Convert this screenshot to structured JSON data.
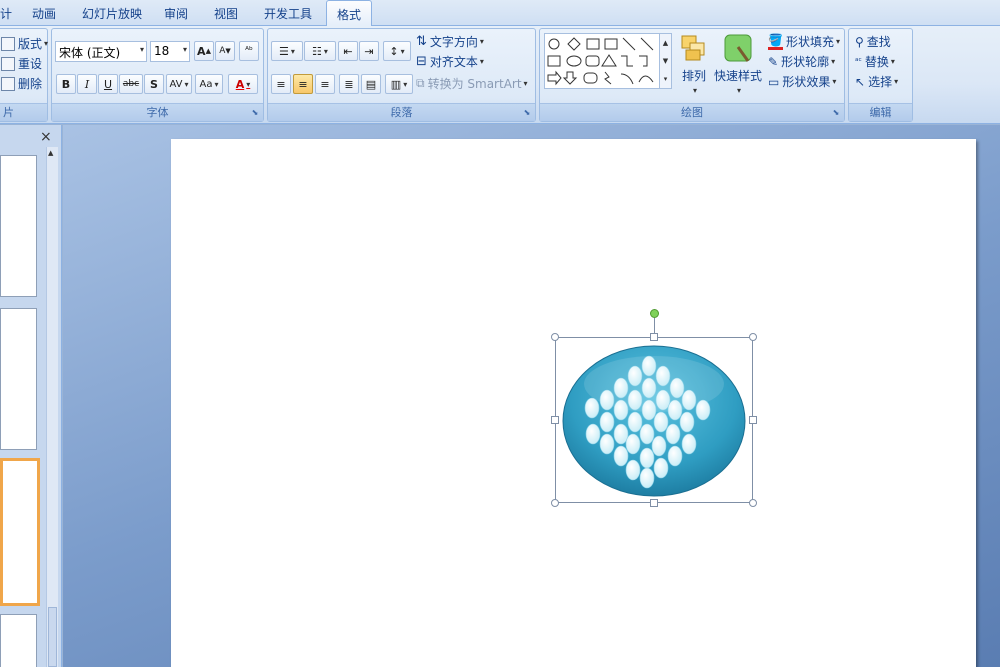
{
  "tabs": [
    {
      "label": "计",
      "x_hint": "first"
    },
    {
      "label": "动画"
    },
    {
      "label": "幻灯片放映"
    },
    {
      "label": "审阅"
    },
    {
      "label": "视图"
    },
    {
      "label": "开发工具"
    },
    {
      "label": "格式"
    }
  ],
  "slides_group": {
    "label": "片",
    "layout": "版式",
    "reset": "重设",
    "delete": "删除"
  },
  "font_group": {
    "label": "字体",
    "font_name": "宋体 (正文)",
    "font_size": "18",
    "bold": "B",
    "italic": "I",
    "underline": "U",
    "strike": "abc",
    "shadow": "S",
    "spacing": "AV",
    "case": "Aa",
    "color": "A",
    "grow": "A",
    "shrink": "A"
  },
  "paragraph_group": {
    "label": "段落",
    "text_direction": "文字方向",
    "align_text": "对齐文本",
    "convert_smartart": "转换为 SmartArt"
  },
  "drawing_group": {
    "label": "绘图",
    "arrange": "排列",
    "quick_styles": "快速样式",
    "shape_fill": "形状填充",
    "shape_outline": "形状轮廓",
    "shape_effects": "形状效果"
  },
  "editing_group": {
    "label": "编辑",
    "find": "查找",
    "replace": "替换",
    "select": "选择"
  },
  "panel": {
    "close": "×"
  },
  "colors": {
    "accent_ribbon": "#dbe7f6",
    "oval_fill": "#3aa6c8",
    "selected_thumb_border": "#f0a64a",
    "rotation_handle": "#7fd15a"
  }
}
